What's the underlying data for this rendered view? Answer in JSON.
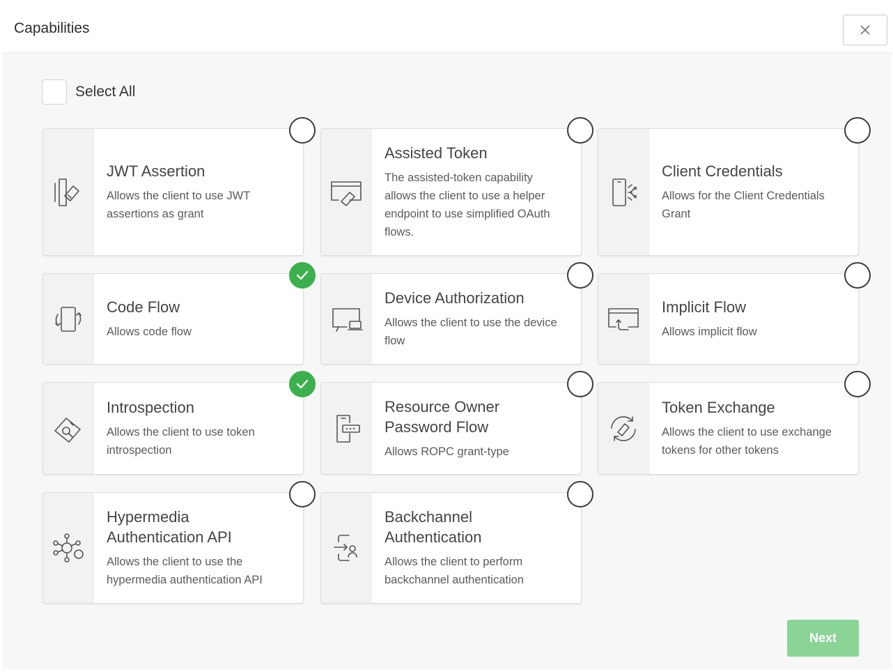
{
  "dialog": {
    "title": "Capabilities",
    "close_icon": "close-icon"
  },
  "select_all": {
    "label": "Select All",
    "checked": false
  },
  "cards": [
    {
      "title": "JWT Assertion",
      "description": "Allows the client to use JWT assertions as grant",
      "icon": "jwt-assertion-icon",
      "checked": false
    },
    {
      "title": "Assisted Token",
      "description": "The assisted-token capability allows the client to use a helper endpoint to use simplified OAuth flows.",
      "icon": "assisted-token-icon",
      "checked": false
    },
    {
      "title": "Client Credentials",
      "description": "Allows for the Client Credentials Grant",
      "icon": "client-credentials-icon",
      "checked": false
    },
    {
      "title": "Code Flow",
      "description": "Allows code flow",
      "icon": "code-flow-icon",
      "checked": true
    },
    {
      "title": "Device Authorization",
      "description": "Allows the client to use the device flow",
      "icon": "device-authorization-icon",
      "checked": false
    },
    {
      "title": "Implicit Flow",
      "description": "Allows implicit flow",
      "icon": "implicit-flow-icon",
      "checked": false
    },
    {
      "title": "Introspection",
      "description": "Allows the client to use token introspection",
      "icon": "introspection-icon",
      "checked": true
    },
    {
      "title": "Resource Owner Password Flow",
      "description": "Allows ROPC grant-type",
      "icon": "resource-owner-password-icon",
      "checked": false
    },
    {
      "title": "Token Exchange",
      "description": "Allows the client to use exchange tokens for other tokens",
      "icon": "token-exchange-icon",
      "checked": false
    },
    {
      "title": "Hypermedia Authentication API",
      "description": "Allows the client to use the hypermedia authentication API",
      "icon": "hypermedia-icon",
      "checked": false
    },
    {
      "title": "Backchannel Authentication",
      "description": "Allows the client to perform backchannel authentication",
      "icon": "backchannel-icon",
      "checked": false
    }
  ],
  "footer": {
    "next_label": "Next"
  },
  "colors": {
    "accent_green": "#3bb04c",
    "next_button_disabled": "#8ad596",
    "card_strip": "#f2f2f2",
    "dialog_bg": "#f7f7f7"
  }
}
